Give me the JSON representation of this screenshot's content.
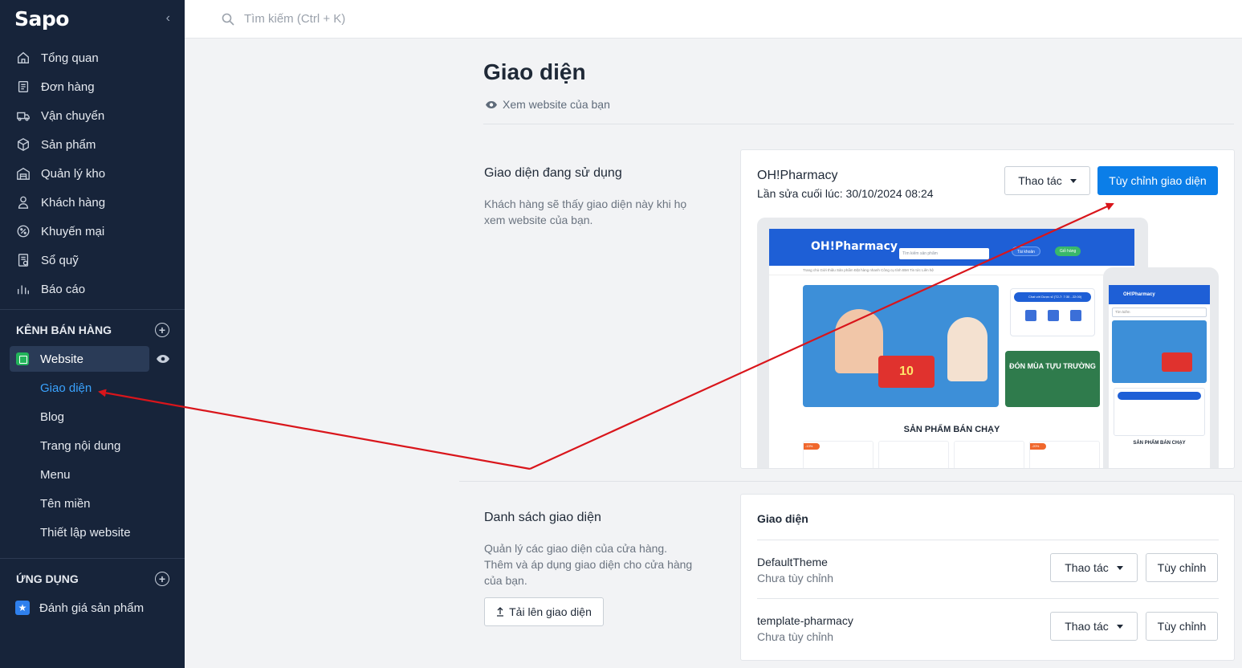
{
  "app": {
    "logo": "Sapo"
  },
  "search": {
    "placeholder": "Tìm kiếm (Ctrl + K)"
  },
  "sidebar": {
    "items": [
      {
        "label": "Tổng quan",
        "icon": "home-icon"
      },
      {
        "label": "Đơn hàng",
        "icon": "order-icon"
      },
      {
        "label": "Vận chuyển",
        "icon": "truck-icon"
      },
      {
        "label": "Sản phẩm",
        "icon": "box-icon"
      },
      {
        "label": "Quản lý kho",
        "icon": "warehouse-icon"
      },
      {
        "label": "Khách hàng",
        "icon": "user-icon"
      },
      {
        "label": "Khuyến mại",
        "icon": "discount-icon"
      },
      {
        "label": "Sổ quỹ",
        "icon": "cashbook-icon"
      },
      {
        "label": "Báo cáo",
        "icon": "chart-icon"
      }
    ],
    "sales_channel_heading": "KÊNH BÁN HÀNG",
    "website_label": "Website",
    "website_subitems": [
      "Giao diện",
      "Blog",
      "Trang nội dung",
      "Menu",
      "Tên miền",
      "Thiết lập website"
    ],
    "apps_heading": "ỨNG DỤNG",
    "apps": [
      {
        "label": "Đánh giá sản phẩm",
        "icon": "star-icon"
      }
    ]
  },
  "page": {
    "title": "Giao diện",
    "view_website": "Xem website của bạn"
  },
  "current_theme": {
    "section_title": "Giao diện đang sử dụng",
    "section_desc": "Khách hàng sẽ thấy giao diện này khi họ xem website của bạn.",
    "name": "OH!Pharmacy",
    "last_edit": "Lần sửa cuối lúc: 30/10/2024 08:24",
    "actions_label": "Thao tác",
    "customize_label": "Tùy chỉnh giao diện",
    "preview": {
      "site_logo": "OH!Pharmacy",
      "site_search": "Tìm kiếm sản phẩm",
      "account": "Tài khoản",
      "cart": "Giỏ hàng",
      "nav": "Trang chủ    Giới thiệu    Sản phẩm    Đặt hàng nhanh    Công cụ tính BMI    Tin tức    Liên hệ",
      "banner_value": "10",
      "side_banner_text": "ĐÓN MÙA TỰU TRƯỜNG",
      "chat_bar": "Chat với Dược sĩ (T2-7: 7:30 - 22:00)",
      "best_sellers": "SẢN PHẨM BÁN CHẠY",
      "discount_tag_1": "-13%",
      "discount_tag_2": "-20%",
      "phone_logo": "OH!Pharmacy",
      "phone_search": "Tìm kiếm"
    }
  },
  "theme_list": {
    "section_title": "Danh sách giao diện",
    "section_desc": "Quản lý các giao diện của cửa hàng. Thêm và áp dụng giao diện cho cửa hàng của bạn.",
    "upload_label": "Tải lên giao diện",
    "header": "Giao diện",
    "themes": [
      {
        "name": "DefaultTheme",
        "status": "Chưa tùy chỉnh",
        "actions_label": "Thao tác",
        "customize_label": "Tùy chỉnh"
      },
      {
        "name": "template-pharmacy",
        "status": "Chưa tùy chỉnh",
        "actions_label": "Thao tác",
        "customize_label": "Tùy chỉnh"
      }
    ]
  },
  "colors": {
    "sidebar_bg": "#17243a",
    "primary": "#0b7ee8",
    "active_link": "#3aa3ff",
    "annotation": "#d9151b"
  }
}
